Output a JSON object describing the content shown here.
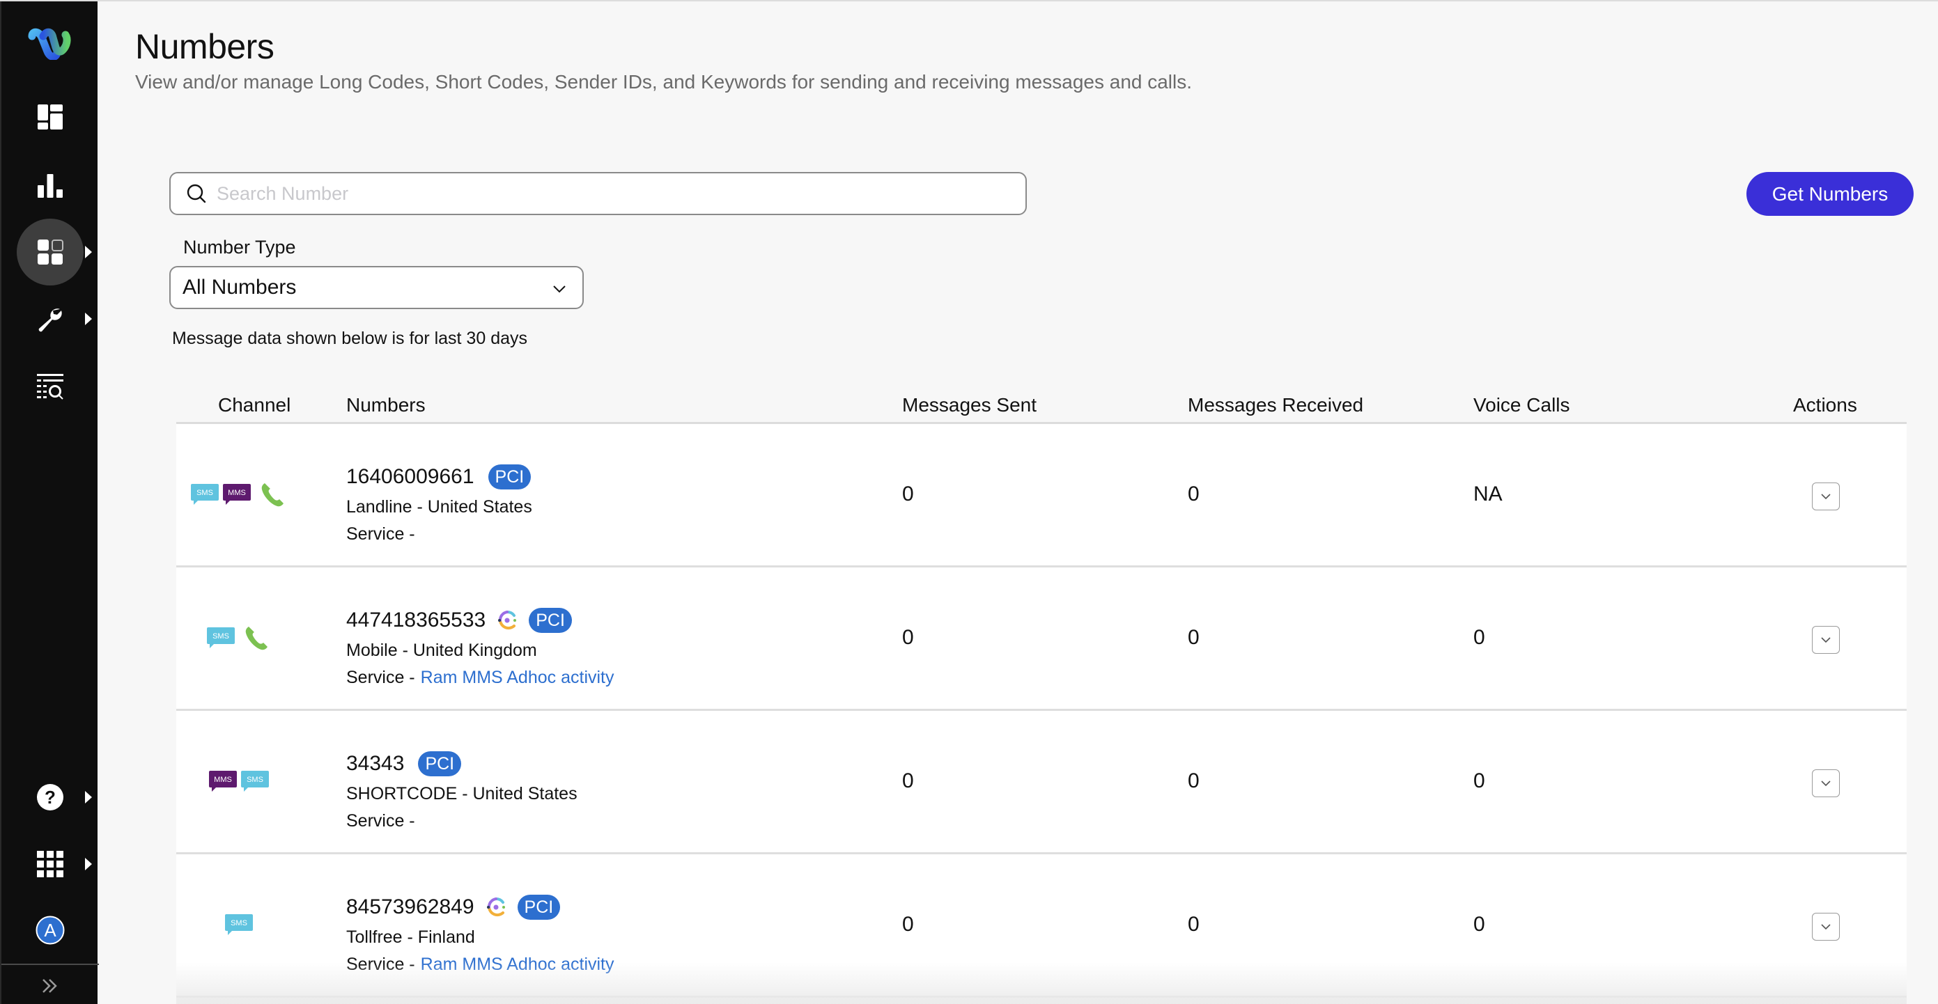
{
  "sidebar": {
    "logo": "webex-logo",
    "items": [
      {
        "name": "dashboard",
        "icon": "dashboard-icon",
        "active": false,
        "has_submenu": false
      },
      {
        "name": "analytics",
        "icon": "bar-chart-icon",
        "active": false,
        "has_submenu": false
      },
      {
        "name": "assets",
        "icon": "apps-grid-icon",
        "active": true,
        "has_submenu": true
      },
      {
        "name": "tools",
        "icon": "wrench-icon",
        "active": false,
        "has_submenu": true
      },
      {
        "name": "logs",
        "icon": "list-search-icon",
        "active": false,
        "has_submenu": false
      }
    ],
    "bottom_items": [
      {
        "name": "help",
        "icon": "help-icon",
        "has_submenu": true
      },
      {
        "name": "app-launcher",
        "icon": "grid-icon",
        "has_submenu": true
      },
      {
        "name": "account",
        "icon": "avatar-icon",
        "avatar_letter": "A"
      }
    ],
    "expand_icon": "double-chevron-right-icon"
  },
  "header": {
    "title": "Numbers",
    "subtitle": "View and/or manage Long Codes, Short Codes, Sender IDs, and Keywords for sending and receiving messages and calls."
  },
  "search": {
    "placeholder": "Search Number",
    "value": ""
  },
  "get_numbers_label": "Get Numbers",
  "colors": {
    "primary_button": "#3a2fd8",
    "pci_badge": "#2d6fcf",
    "link": "#2d6fcf",
    "sms": "#5fc3df",
    "mms": "#5e1a6e",
    "voice": "#7cc151",
    "sidebar_bg": "#0e0e0e"
  },
  "filter": {
    "label": "Number Type",
    "selected": "All Numbers"
  },
  "note": "Message data shown below is for last 30 days",
  "table": {
    "columns": [
      "Channel",
      "Numbers",
      "Messages Sent",
      "Messages Received",
      "Voice Calls",
      "Actions"
    ],
    "rows": [
      {
        "channels": [
          "SMS",
          "MMS",
          "VOICE"
        ],
        "number": "16406009661",
        "ai_enabled": false,
        "badge": "PCI",
        "type_country": "Landline - United States",
        "service_label": "Service -",
        "service_link": "",
        "messages_sent": "0",
        "messages_received": "0",
        "voice_calls": "NA"
      },
      {
        "channels": [
          "SMS",
          "VOICE"
        ],
        "number": "447418365533",
        "ai_enabled": true,
        "badge": "PCI",
        "type_country": "Mobile - United Kingdom",
        "service_label": "Service -",
        "service_link": "Ram MMS Adhoc activity",
        "messages_sent": "0",
        "messages_received": "0",
        "voice_calls": "0"
      },
      {
        "channels": [
          "MMS",
          "SMS"
        ],
        "number": "34343",
        "ai_enabled": false,
        "badge": "PCI",
        "type_country": "SHORTCODE - United States",
        "service_label": "Service -",
        "service_link": "",
        "messages_sent": "0",
        "messages_received": "0",
        "voice_calls": "0"
      },
      {
        "channels": [
          "SMS"
        ],
        "number": "84573962849",
        "ai_enabled": true,
        "badge": "PCI",
        "type_country": "Tollfree - Finland",
        "service_label": "Service -",
        "service_link": "Ram MMS Adhoc activity",
        "messages_sent": "0",
        "messages_received": "0",
        "voice_calls": "0"
      }
    ]
  }
}
